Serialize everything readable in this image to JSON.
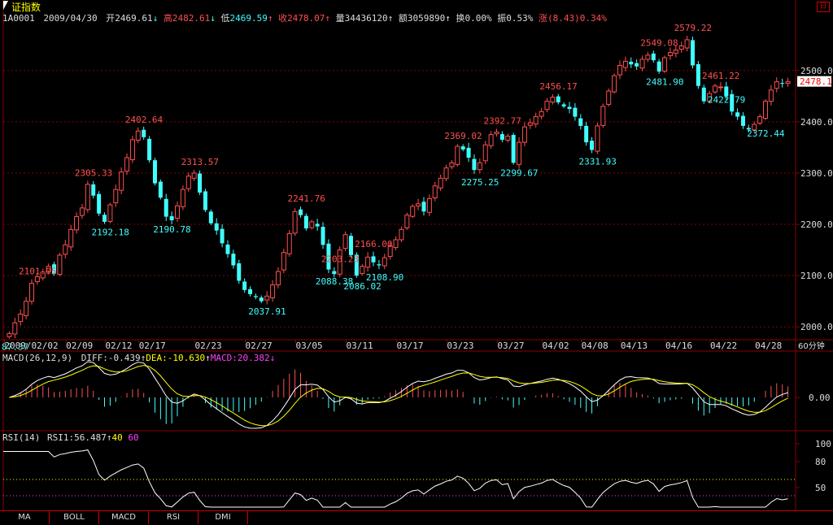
{
  "header": {
    "title": "证指数",
    "code": "1A0001",
    "date": "2009/04/30",
    "open_label": "开",
    "open": "2469.61",
    "high_label": "高",
    "high": "2482.61",
    "low_label": "低",
    "low": "2469.59",
    "close_label": "收",
    "close": "2478.07",
    "volume_label": "量",
    "volume": "34436120",
    "amount_label": "额",
    "amount": "3059890",
    "turnover_label": "换",
    "turnover": "0.00%",
    "amplitude_label": "振",
    "amplitude": "0.53%",
    "change_label": "涨",
    "change": "(8.43)0.34%",
    "corner_button": "日"
  },
  "colors": {
    "up": "#ff5050",
    "down": "#40ffff",
    "grid": "#8b0000",
    "label": "#dddddd",
    "price_tag": "#ff0000"
  },
  "chart_data": [
    {
      "type": "candlestick",
      "current_price_tag": "2478.1",
      "y_ticks": [
        2000,
        2100,
        2200,
        2300,
        2400,
        2500
      ],
      "y_tick_labels": [
        "2000.0",
        "2100.0",
        "2200.0",
        "2300.0",
        "2400.0",
        "2500.0"
      ],
      "ylim": [
        1975,
        2590
      ],
      "period_label": "60分钟",
      "x_labels": [
        {
          "i": 0,
          "label": "2009/02/02"
        },
        {
          "i": 11,
          "label": "02/09"
        },
        {
          "i": 18,
          "label": "02/12"
        },
        {
          "i": 24,
          "label": "02/17"
        },
        {
          "i": 34,
          "label": "02/23"
        },
        {
          "i": 43,
          "label": "02/27"
        },
        {
          "i": 52,
          "label": "03/05"
        },
        {
          "i": 61,
          "label": "03/11"
        },
        {
          "i": 70,
          "label": "03/17"
        },
        {
          "i": 79,
          "label": "03/23"
        },
        {
          "i": 88,
          "label": "03/27"
        },
        {
          "i": 96,
          "label": "04/02"
        },
        {
          "i": 103,
          "label": "04/08"
        },
        {
          "i": 110,
          "label": "04/13"
        },
        {
          "i": 118,
          "label": "04/16"
        },
        {
          "i": 126,
          "label": "04/22"
        },
        {
          "i": 134,
          "label": "04/28"
        }
      ],
      "highlights": [
        {
          "i": 0,
          "text": "87.37",
          "kind": "low"
        },
        {
          "i": 4,
          "text": "2101.05",
          "kind": "high"
        },
        {
          "i": 14,
          "text": "2305.33",
          "kind": "high"
        },
        {
          "i": 17,
          "text": "2192.18",
          "kind": "low"
        },
        {
          "i": 23,
          "text": "2402.64",
          "kind": "high"
        },
        {
          "i": 28,
          "text": "2190.78",
          "kind": "low"
        },
        {
          "i": 33,
          "text": "2313.57",
          "kind": "high"
        },
        {
          "i": 45,
          "text": "2037.91",
          "kind": "low"
        },
        {
          "i": 52,
          "text": "2241.76",
          "kind": "high"
        },
        {
          "i": 57,
          "text": "2088.38",
          "kind": "low"
        },
        {
          "i": 58,
          "text": "2203.23",
          "kind": "high"
        },
        {
          "i": 62,
          "text": "2086.02",
          "kind": "low"
        },
        {
          "i": 64,
          "text": "2166.00",
          "kind": "high"
        },
        {
          "i": 66,
          "text": "2108.90",
          "kind": "low"
        },
        {
          "i": 80,
          "text": "2369.02",
          "kind": "high"
        },
        {
          "i": 83,
          "text": "2275.25",
          "kind": "low"
        },
        {
          "i": 87,
          "text": "2392.77",
          "kind": "high"
        },
        {
          "i": 90,
          "text": "2299.67",
          "kind": "low"
        },
        {
          "i": 97,
          "text": "2456.17",
          "kind": "high"
        },
        {
          "i": 104,
          "text": "2331.93",
          "kind": "low"
        },
        {
          "i": 115,
          "text": "2549.08",
          "kind": "high"
        },
        {
          "i": 116,
          "text": "2481.90",
          "kind": "low"
        },
        {
          "i": 121,
          "text": "2579.22",
          "kind": "high"
        },
        {
          "i": 126,
          "text": "2461.22",
          "kind": "high"
        },
        {
          "i": 127,
          "text": "2422.79",
          "kind": "low"
        },
        {
          "i": 134,
          "text": "2372.44",
          "kind": "low"
        }
      ],
      "closes": [
        1987,
        2008,
        2025,
        2050,
        2085,
        2098,
        2107,
        2118,
        2104,
        2140,
        2160,
        2190,
        2215,
        2232,
        2278,
        2256,
        2221,
        2205,
        2238,
        2268,
        2302,
        2330,
        2365,
        2382,
        2370,
        2325,
        2280,
        2252,
        2215,
        2208,
        2236,
        2268,
        2294,
        2300,
        2262,
        2228,
        2202,
        2188,
        2163,
        2142,
        2120,
        2090,
        2072,
        2064,
        2058,
        2050,
        2060,
        2082,
        2108,
        2145,
        2182,
        2225,
        2218,
        2192,
        2205,
        2196,
        2160,
        2112,
        2103,
        2150,
        2180,
        2140,
        2100,
        2118,
        2136,
        2126,
        2120,
        2135,
        2158,
        2170,
        2190,
        2218,
        2235,
        2240,
        2225,
        2250,
        2275,
        2290,
        2310,
        2320,
        2352,
        2346,
        2330,
        2306,
        2320,
        2355,
        2375,
        2380,
        2365,
        2372,
        2320,
        2360,
        2390,
        2398,
        2410,
        2420,
        2440,
        2448,
        2438,
        2430,
        2425,
        2410,
        2392,
        2360,
        2345,
        2392,
        2430,
        2460,
        2490,
        2510,
        2518,
        2512,
        2508,
        2522,
        2530,
        2520,
        2498,
        2525,
        2535,
        2540,
        2548,
        2560,
        2510,
        2470,
        2440,
        2455,
        2470,
        2468,
        2450,
        2420,
        2410,
        2392,
        2385,
        2395,
        2410,
        2440,
        2462,
        2478,
        2474,
        2478
      ]
    },
    {
      "type": "line",
      "indicator": "MACD",
      "label": "MACD(26,12,9)",
      "diff_label": "DIFF:",
      "diff": "-0.439",
      "dea_label": "DEA:",
      "dea": "-10.630",
      "macd_label": "MACD:",
      "macd": "20.382",
      "y_tick_labels": [
        "0.00"
      ]
    },
    {
      "type": "line",
      "indicator": "RSI",
      "label": "RSI(14)",
      "rsi_label": "RSI1:",
      "rsi": "56.487",
      "level_a": "40",
      "level_b": "60",
      "y_ticks": [
        100,
        80,
        50
      ],
      "y_tick_labels": [
        "100",
        "80",
        "50"
      ]
    }
  ],
  "tabs": [
    "MA",
    "BOLL",
    "MACD",
    "RSI",
    "DMI"
  ]
}
